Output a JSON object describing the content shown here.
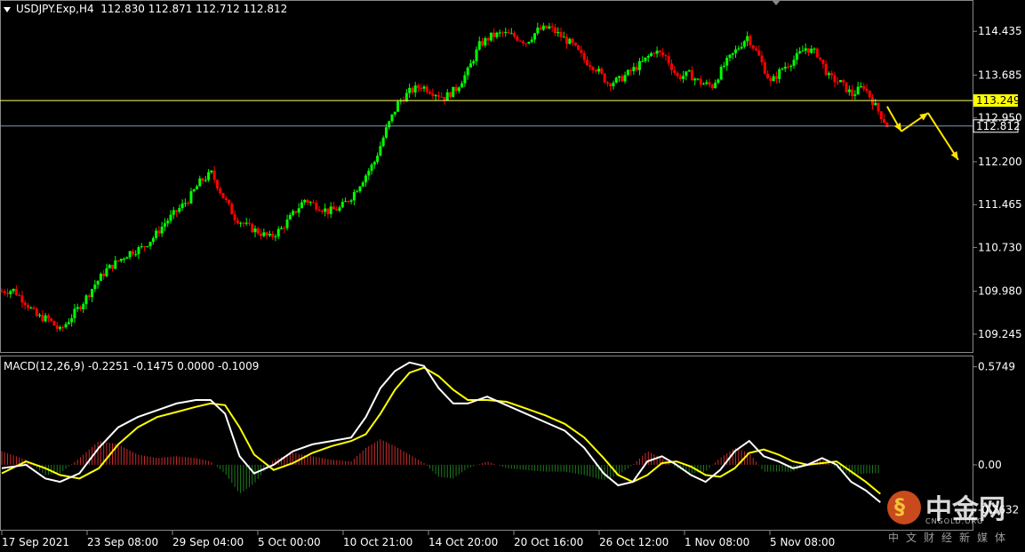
{
  "header": {
    "symbol": "USDJPY.Exp,H4",
    "ohlc": "112.830 112.871 112.712 112.812"
  },
  "macd_header": {
    "label": "MACD(12,26,9) -0.2251 -0.1475 0.0000 -0.1009"
  },
  "logo": {
    "mark": "中金网",
    "sub": "CNGOLD.ORG",
    "tagline": "中文财经新媒体"
  },
  "colors": {
    "background": "#000000",
    "bull_candle": "#00ff00",
    "bear_candle": "#ff0000",
    "macd_line": "#ffffff",
    "signal_line": "#ffff00",
    "hist_positive": "#cc2b2b",
    "hist_negative": "#1e7a1e",
    "resistance_line": "#ffff66",
    "price_line": "#8899aa",
    "forecast_arrow": "#ffe600"
  },
  "chart_data": [
    {
      "type": "candlestick",
      "name": "USDJPY.Exp,H4",
      "y_ticks": [
        "114.435",
        "113.685",
        "112.950",
        "112.200",
        "111.465",
        "110.730",
        "109.980",
        "109.245"
      ],
      "ylim": [
        109.0,
        114.85
      ],
      "x_ticks": [
        "17 Sep 2021",
        "23 Sep 08:00",
        "29 Sep 04:00",
        "5 Oct 00:00",
        "10 Oct 21:00",
        "14 Oct 20:00",
        "20 Oct 16:00",
        "26 Oct 12:00",
        "1 Nov 08:00",
        "5 Nov 08:00"
      ],
      "horizontal_lines": [
        {
          "value": 113.249,
          "label": "113.249",
          "style": "resistance"
        },
        {
          "value": 112.812,
          "label": "112.812",
          "style": "current_price"
        }
      ],
      "close_path": [
        [
          0,
          109.98
        ],
        [
          12,
          110.0
        ],
        [
          24,
          109.8
        ],
        [
          36,
          109.55
        ],
        [
          48,
          109.5
        ],
        [
          60,
          109.3
        ],
        [
          72,
          109.55
        ],
        [
          84,
          109.8
        ],
        [
          96,
          110.1
        ],
        [
          108,
          110.35
        ],
        [
          120,
          110.5
        ],
        [
          132,
          110.65
        ],
        [
          144,
          110.72
        ],
        [
          156,
          110.9
        ],
        [
          168,
          111.15
        ],
        [
          180,
          111.35
        ],
        [
          192,
          111.55
        ],
        [
          204,
          111.85
        ],
        [
          216,
          112.0
        ],
        [
          228,
          111.6
        ],
        [
          240,
          111.25
        ],
        [
          252,
          111.1
        ],
        [
          264,
          111.0
        ],
        [
          276,
          110.9
        ],
        [
          288,
          111.05
        ],
        [
          300,
          111.3
        ],
        [
          312,
          111.55
        ],
        [
          324,
          111.45
        ],
        [
          336,
          111.35
        ],
        [
          348,
          111.4
        ],
        [
          360,
          111.6
        ],
        [
          372,
          111.9
        ],
        [
          384,
          112.2
        ],
        [
          396,
          112.75
        ],
        [
          408,
          113.2
        ],
        [
          420,
          113.4
        ],
        [
          432,
          113.5
        ],
        [
          444,
          113.4
        ],
        [
          456,
          113.3
        ],
        [
          468,
          113.45
        ],
        [
          480,
          113.75
        ],
        [
          492,
          114.2
        ],
        [
          504,
          114.35
        ],
        [
          516,
          114.4
        ],
        [
          528,
          114.35
        ],
        [
          540,
          114.25
        ],
        [
          552,
          114.45
        ],
        [
          564,
          114.5
        ],
        [
          576,
          114.35
        ],
        [
          588,
          114.2
        ],
        [
          600,
          113.95
        ],
        [
          612,
          113.8
        ],
        [
          624,
          113.55
        ],
        [
          636,
          113.6
        ],
        [
          648,
          113.75
        ],
        [
          660,
          113.9
        ],
        [
          672,
          114.1
        ],
        [
          684,
          114.0
        ],
        [
          696,
          113.65
        ],
        [
          708,
          113.7
        ],
        [
          720,
          113.55
        ],
        [
          732,
          113.5
        ],
        [
          744,
          113.85
        ],
        [
          756,
          114.1
        ],
        [
          768,
          114.35
        ],
        [
          780,
          114.0
        ],
        [
          792,
          113.55
        ],
        [
          804,
          113.8
        ],
        [
          816,
          113.95
        ],
        [
          828,
          114.15
        ],
        [
          840,
          114.05
        ],
        [
          852,
          113.65
        ],
        [
          864,
          113.55
        ],
        [
          876,
          113.35
        ],
        [
          888,
          113.5
        ],
        [
          900,
          113.15
        ],
        [
          912,
          112.82
        ]
      ]
    },
    {
      "type": "line",
      "name": "MACD(12,26,9)",
      "y_ticks": [
        "0.5749",
        "0.00",
        "-0.2632"
      ],
      "ylim": [
        -0.36,
        0.62
      ],
      "series": [
        {
          "name": "macd",
          "points": [
            [
              0,
              -0.02
            ],
            [
              25,
              0.0
            ],
            [
              45,
              -0.08
            ],
            [
              60,
              -0.1
            ],
            [
              80,
              -0.05
            ],
            [
              100,
              0.1
            ],
            [
              120,
              0.22
            ],
            [
              140,
              0.28
            ],
            [
              160,
              0.32
            ],
            [
              180,
              0.36
            ],
            [
              200,
              0.38
            ],
            [
              215,
              0.38
            ],
            [
              230,
              0.3
            ],
            [
              245,
              0.05
            ],
            [
              260,
              -0.05
            ],
            [
              280,
              0.0
            ],
            [
              300,
              0.08
            ],
            [
              320,
              0.12
            ],
            [
              340,
              0.14
            ],
            [
              360,
              0.16
            ],
            [
              375,
              0.28
            ],
            [
              390,
              0.45
            ],
            [
              405,
              0.55
            ],
            [
              420,
              0.6
            ],
            [
              435,
              0.58
            ],
            [
              450,
              0.45
            ],
            [
              465,
              0.36
            ],
            [
              480,
              0.36
            ],
            [
              500,
              0.4
            ],
            [
              520,
              0.35
            ],
            [
              540,
              0.3
            ],
            [
              560,
              0.25
            ],
            [
              580,
              0.2
            ],
            [
              600,
              0.1
            ],
            [
              620,
              -0.05
            ],
            [
              635,
              -0.12
            ],
            [
              650,
              -0.1
            ],
            [
              665,
              0.02
            ],
            [
              680,
              0.05
            ],
            [
              695,
              0.0
            ],
            [
              710,
              -0.06
            ],
            [
              725,
              -0.1
            ],
            [
              740,
              -0.03
            ],
            [
              755,
              0.08
            ],
            [
              770,
              0.14
            ],
            [
              785,
              0.05
            ],
            [
              800,
              0.02
            ],
            [
              815,
              -0.02
            ],
            [
              830,
              0.0
            ],
            [
              845,
              0.04
            ],
            [
              860,
              0.0
            ],
            [
              875,
              -0.1
            ],
            [
              890,
              -0.15
            ],
            [
              905,
              -0.22
            ]
          ]
        },
        {
          "name": "signal",
          "points": [
            [
              0,
              -0.05
            ],
            [
              25,
              0.02
            ],
            [
              45,
              -0.02
            ],
            [
              60,
              -0.06
            ],
            [
              80,
              -0.08
            ],
            [
              100,
              -0.02
            ],
            [
              120,
              0.12
            ],
            [
              140,
              0.22
            ],
            [
              160,
              0.28
            ],
            [
              180,
              0.31
            ],
            [
              200,
              0.34
            ],
            [
              215,
              0.36
            ],
            [
              230,
              0.35
            ],
            [
              245,
              0.22
            ],
            [
              260,
              0.06
            ],
            [
              280,
              -0.03
            ],
            [
              300,
              0.01
            ],
            [
              320,
              0.07
            ],
            [
              340,
              0.11
            ],
            [
              360,
              0.14
            ],
            [
              375,
              0.18
            ],
            [
              390,
              0.3
            ],
            [
              405,
              0.44
            ],
            [
              420,
              0.54
            ],
            [
              435,
              0.57
            ],
            [
              450,
              0.52
            ],
            [
              465,
              0.44
            ],
            [
              480,
              0.38
            ],
            [
              500,
              0.38
            ],
            [
              520,
              0.37
            ],
            [
              540,
              0.33
            ],
            [
              560,
              0.29
            ],
            [
              580,
              0.24
            ],
            [
              600,
              0.16
            ],
            [
              620,
              0.04
            ],
            [
              635,
              -0.06
            ],
            [
              650,
              -0.1
            ],
            [
              665,
              -0.06
            ],
            [
              680,
              0.01
            ],
            [
              695,
              0.02
            ],
            [
              710,
              -0.01
            ],
            [
              725,
              -0.06
            ],
            [
              740,
              -0.07
            ],
            [
              755,
              -0.02
            ],
            [
              770,
              0.07
            ],
            [
              785,
              0.09
            ],
            [
              800,
              0.06
            ],
            [
              815,
              0.02
            ],
            [
              830,
              0.0
            ],
            [
              845,
              0.01
            ],
            [
              860,
              0.02
            ],
            [
              875,
              -0.04
            ],
            [
              890,
              -0.1
            ],
            [
              905,
              -0.17
            ]
          ]
        },
        {
          "name": "histogram",
          "points": [
            [
              0,
              0.08
            ],
            [
              25,
              0.03
            ],
            [
              45,
              -0.06
            ],
            [
              60,
              -0.05
            ],
            [
              80,
              0.04
            ],
            [
              100,
              0.14
            ],
            [
              120,
              0.12
            ],
            [
              140,
              0.06
            ],
            [
              160,
              0.04
            ],
            [
              180,
              0.05
            ],
            [
              200,
              0.04
            ],
            [
              215,
              0.02
            ],
            [
              230,
              -0.05
            ],
            [
              245,
              -0.17
            ],
            [
              260,
              -0.11
            ],
            [
              280,
              0.03
            ],
            [
              300,
              0.07
            ],
            [
              320,
              0.05
            ],
            [
              340,
              0.03
            ],
            [
              360,
              0.02
            ],
            [
              375,
              0.1
            ],
            [
              390,
              0.15
            ],
            [
              405,
              0.11
            ],
            [
              420,
              0.06
            ],
            [
              435,
              0.01
            ],
            [
              450,
              -0.07
            ],
            [
              465,
              -0.08
            ],
            [
              480,
              -0.02
            ],
            [
              500,
              0.02
            ],
            [
              520,
              -0.02
            ],
            [
              540,
              -0.03
            ],
            [
              560,
              -0.04
            ],
            [
              580,
              -0.04
            ],
            [
              600,
              -0.06
            ],
            [
              620,
              -0.09
            ],
            [
              635,
              -0.06
            ],
            [
              650,
              0.0
            ],
            [
              665,
              0.08
            ],
            [
              680,
              0.04
            ],
            [
              695,
              -0.02
            ],
            [
              710,
              -0.05
            ],
            [
              725,
              -0.04
            ],
            [
              740,
              0.04
            ],
            [
              755,
              0.1
            ],
            [
              770,
              0.07
            ],
            [
              785,
              -0.04
            ],
            [
              800,
              -0.04
            ],
            [
              815,
              -0.04
            ],
            [
              830,
              0.0
            ],
            [
              845,
              0.03
            ],
            [
              860,
              -0.02
            ],
            [
              875,
              -0.06
            ],
            [
              890,
              -0.05
            ],
            [
              905,
              -0.05
            ]
          ]
        }
      ]
    }
  ]
}
